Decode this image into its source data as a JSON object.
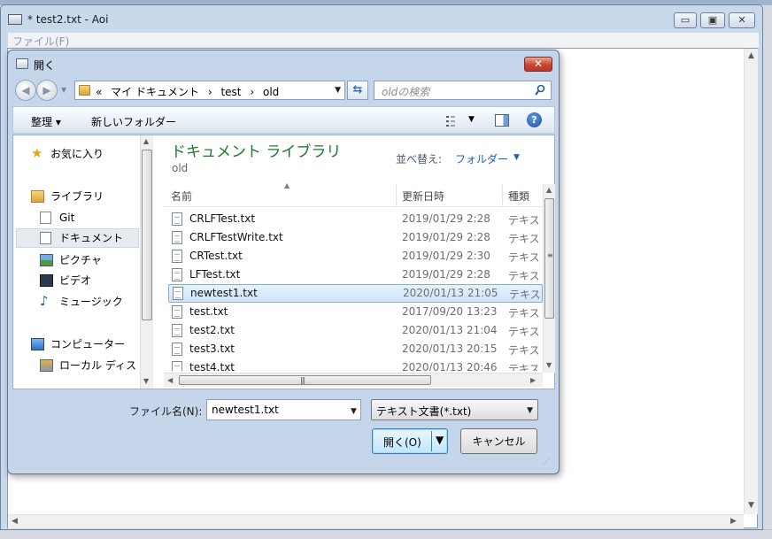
{
  "main_window": {
    "title": "* test2.txt - Aoi",
    "menu_file": "ファイル(F)",
    "btn_min": "▭",
    "btn_max": "▣",
    "btn_close": "✕"
  },
  "dialog": {
    "title": "開く",
    "close_glyph": "✕",
    "address": {
      "crumbs": [
        "«",
        "マイ ドキュメント",
        "›",
        "test",
        "›",
        "old"
      ]
    },
    "search": {
      "placeholder": "oldの検索"
    },
    "toolbar": {
      "organize": "整理 ▾",
      "new_folder": "新しいフォルダー"
    },
    "nav": {
      "favorites": "お気に入り",
      "libraries": "ライブラリ",
      "git": "Git",
      "documents": "ドキュメント",
      "pictures": "ピクチャ",
      "videos": "ビデオ",
      "music": "ミュージック",
      "computer": "コンピューター",
      "local_disk": "ローカル ディス"
    },
    "library": {
      "title": "ドキュメント ライブラリ",
      "subtitle": "old",
      "sort_label": "並べ替え:",
      "sort_value": "フォルダー"
    },
    "columns": {
      "name": "名前",
      "date": "更新日時",
      "type": "種類"
    },
    "files": [
      {
        "name": "CRLFTest.txt",
        "date": "2019/01/29 2:28",
        "type": "テキスト文書"
      },
      {
        "name": "CRLFTestWrite.txt",
        "date": "2019/01/29 2:28",
        "type": "テキスト文書"
      },
      {
        "name": "CRTest.txt",
        "date": "2019/01/29 2:30",
        "type": "テキスト文書"
      },
      {
        "name": "LFTest.txt",
        "date": "2019/01/29 2:28",
        "type": "テキスト文書"
      },
      {
        "name": "newtest1.txt",
        "date": "2020/01/13 21:05",
        "type": "テキスト文書"
      },
      {
        "name": "test.txt",
        "date": "2017/09/20 13:23",
        "type": "テキスト文書"
      },
      {
        "name": "test2.txt",
        "date": "2020/01/13 21:04",
        "type": "テキスト文書"
      },
      {
        "name": "test3.txt",
        "date": "2020/01/13 20:15",
        "type": "テキスト文書"
      },
      {
        "name": "test4.txt",
        "date": "2020/01/13 20:46",
        "type": "テキスト文書"
      }
    ],
    "selected_file_index": 4,
    "bottom": {
      "filename_label": "ファイル名(N):",
      "filename_value": "newtest1.txt",
      "filetype_value": "テキスト文書(*.txt)",
      "open_label": "開く(O)",
      "cancel_label": "キャンセル"
    }
  },
  "colors": {
    "library_title": "#1c7a2c",
    "sort_link": "#1d61b1",
    "selection_border": "#84acdd",
    "close_button": "#c9452f"
  }
}
